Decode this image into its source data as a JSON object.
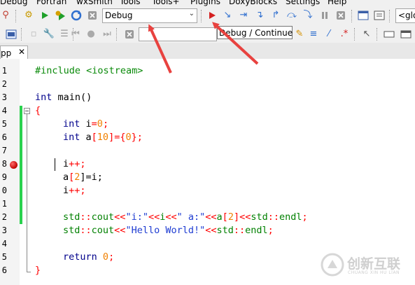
{
  "menu": {
    "items": [
      "Debug",
      "Fortran",
      "wxSmith",
      "Tools",
      "Tools+",
      "Plugins",
      "DoxyBlocks",
      "Settings",
      "Help"
    ]
  },
  "toolbar": {
    "build_target": "Debug",
    "scope_combo": "<glo",
    "tooltip": "Debug / Continue"
  },
  "editor": {
    "tab_label": "pp",
    "line_numbers": [
      "1",
      "2",
      "3",
      "4",
      "5",
      "6",
      "7",
      "8",
      "9",
      "0",
      "1",
      "2",
      "3",
      "4",
      "5",
      "6"
    ],
    "lines": {
      "l1_directive": "#include",
      "l1_header": " <iostream>",
      "l3_type": "int",
      "l3_rest": " main()",
      "l4_brace": "{",
      "l5_type": "int",
      "l5_rest": " i",
      "l5_eq": "=",
      "l5_val": "0",
      "l5_semi": ";",
      "l6_type": "int",
      "l6_rest": " a",
      "l6_lb": "[",
      "l6_size": "10",
      "l6_tail_a": "]={",
      "l6_init": "0",
      "l6_tail_b": "};",
      "l8_var": "i",
      "l8_op": "++;",
      "l9_var": "a",
      "l9_lb": "[",
      "l9_idx": "2",
      "l9_rest": "]=i;",
      "l10_var": "i",
      "l10_op": "++;",
      "l12_ns": "std",
      "l12_sc": "::",
      "l12_obj": "cout",
      "l12_op1": "<<",
      "l12_s1": "\"i:\"",
      "l12_op2": "<<",
      "l12_v1": "i",
      "l12_op3": "<<",
      "l12_s2": "\" a:\"",
      "l12_op4": "<<",
      "l12_v2": "a",
      "l12_lb": "[",
      "l12_idx": "2",
      "l12_rb": "]",
      "l12_op5": "<<",
      "l12_ns2": "std",
      "l12_sc2": "::",
      "l12_endl": "endl",
      "l12_semi": ";",
      "l13_ns": "std",
      "l13_sc": "::",
      "l13_obj": "cout",
      "l13_op1": "<<",
      "l13_str": "\"Hello World!\"",
      "l13_op2": "<<",
      "l13_ns2": "std",
      "l13_sc2": "::",
      "l13_endl": "endl",
      "l13_semi": ";",
      "l15_kw": "return",
      "l15_val": "0",
      "l15_semi": ";",
      "l16_brace": "}"
    },
    "breakpoint_line": "8"
  },
  "watermark": {
    "text": "创新互联",
    "sub": "CHUANG XIN HU LIAN"
  },
  "colors": {
    "arrow": "#e8423f",
    "run_green": "#1fa02a",
    "change_bar": "#2ad24e"
  }
}
